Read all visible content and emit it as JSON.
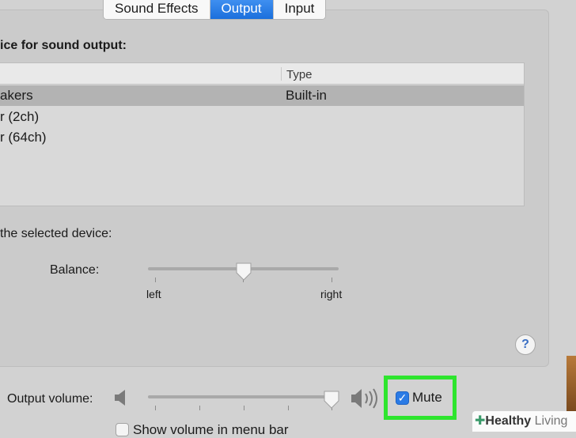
{
  "tabs": [
    {
      "label": "Sound Effects",
      "active": false
    },
    {
      "label": "Output",
      "active": true
    },
    {
      "label": "Input",
      "active": false
    }
  ],
  "heading": "ice for sound output:",
  "table": {
    "columns": [
      "Type"
    ],
    "rows": [
      {
        "name": "akers",
        "type": "Built-in",
        "selected": true
      },
      {
        "name": "r (2ch)",
        "type": ""
      },
      {
        "name": "r (64ch)",
        "type": ""
      }
    ]
  },
  "settings_heading": "the selected device:",
  "balance": {
    "label": "Balance:",
    "left_label": "left",
    "right_label": "right",
    "value_fraction": 0.5
  },
  "help": {
    "icon": "question-icon",
    "glyph": "?"
  },
  "output_volume": {
    "label": "Output volume:",
    "value_fraction": 0.96,
    "icon_low": "speaker-low-icon",
    "icon_high": "speaker-high-icon"
  },
  "mute": {
    "label": "Mute",
    "checked": true,
    "check_glyph": "✓"
  },
  "show_volume": {
    "label": "Show volume in menu bar",
    "checked": false
  },
  "watermark": {
    "plus": "✚",
    "brand_a": "Healthy",
    "brand_b": " Living"
  },
  "colors": {
    "accent": "#1b6fdc",
    "highlight": "#2ee52e"
  }
}
